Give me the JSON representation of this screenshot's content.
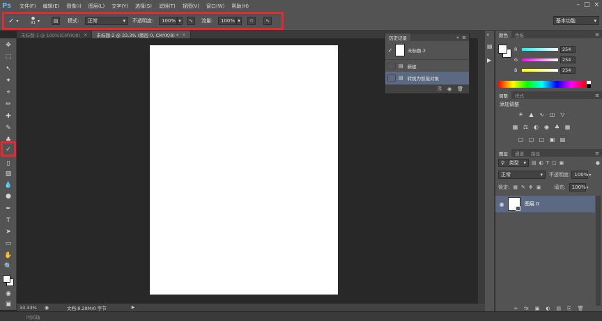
{
  "app": {
    "logo": "Ps"
  },
  "menu": [
    "文件(F)",
    "编辑(E)",
    "图像(I)",
    "图层(L)",
    "文字(Y)",
    "选择(S)",
    "滤镜(T)",
    "视图(V)",
    "窗口(W)",
    "帮助(H)"
  ],
  "options": {
    "brush_size": "91",
    "mode_label": "模式:",
    "mode_value": "正常",
    "opacity_label": "不透明度:",
    "opacity_value": "100%",
    "flow_label": "流量:",
    "flow_value": "100%",
    "workspace": "基本功能"
  },
  "tabs": [
    {
      "label": "未标题-1 @ 100%(CMYK/8)",
      "active": false
    },
    {
      "label": "未标题-2 @ 33.3% (图层 0, CMYK/8) *",
      "active": true
    }
  ],
  "history": {
    "tab": "历史记录",
    "snapshot": "未标题-2",
    "items": [
      "新建",
      "转换为智能对象"
    ]
  },
  "color_panel": {
    "tabs": [
      "颜色",
      "色板"
    ],
    "channels": [
      {
        "label": "R",
        "value": "254"
      },
      {
        "label": "G",
        "value": "254"
      },
      {
        "label": "B",
        "value": "254"
      }
    ]
  },
  "adjust_panel": {
    "tabs": [
      "调整",
      "样式"
    ],
    "title": "添加调整"
  },
  "layers_panel": {
    "tabs": [
      "图层",
      "通道",
      "路径"
    ],
    "filter": "类型",
    "blend_mode": "正常",
    "opacity_label": "不透明度:",
    "opacity_value": "100%",
    "lock_label": "锁定:",
    "fill_label": "填充:",
    "fill_value": "100%",
    "layer_name": "图层 0"
  },
  "status": {
    "zoom": "33.33%",
    "doc_info": "文档:8.28M/0 字节"
  },
  "timeline": "时间轴",
  "colors": {
    "highlight": "#e8282f",
    "panel_bg": "#535353",
    "canvas_bg": "#282828",
    "selected_row": "#5b6a82"
  }
}
